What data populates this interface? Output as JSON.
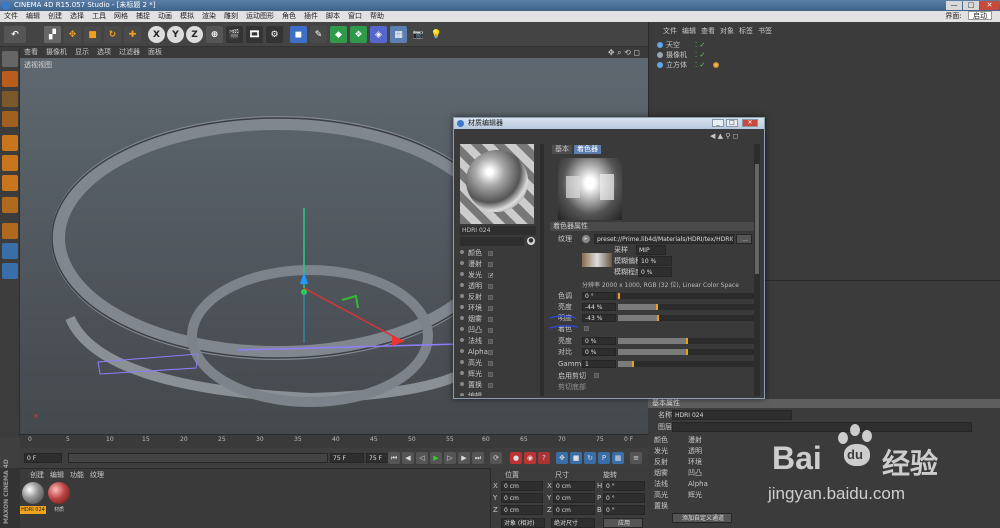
{
  "window": {
    "title": "CINEMA 4D R15.057 Studio - [未标题 2 *]",
    "min": "—",
    "max": "□",
    "close": "✕"
  },
  "menu": {
    "items": [
      "文件",
      "编辑",
      "创建",
      "选择",
      "工具",
      "网格",
      "捕捉",
      "动画",
      "模拟",
      "渲染",
      "雕刻",
      "运动图形",
      "角色",
      "插件",
      "脚本",
      "窗口",
      "帮助"
    ],
    "layout_label": "界面:",
    "layout_value": "启动"
  },
  "viewport": {
    "menu": [
      "查看",
      "摄像机",
      "显示",
      "选项",
      "过滤器",
      "面板"
    ],
    "label": "透视视图"
  },
  "timeline": {
    "ticks": [
      "0",
      "5",
      "10",
      "15",
      "20",
      "25",
      "30",
      "35",
      "40",
      "45",
      "50",
      "55",
      "60",
      "65",
      "70",
      "75"
    ],
    "end": "0 F"
  },
  "playback": {
    "start": "0 F",
    "current": "0 F",
    "end": "75 F",
    "end2": "75 F"
  },
  "material_manager": {
    "menu": [
      "创建",
      "编辑",
      "功能",
      "纹理"
    ],
    "materials": [
      {
        "name": "HDRI 024"
      },
      {
        "name": "材质"
      }
    ]
  },
  "maxon_label": "MAXON CINEMA 4D",
  "coords": {
    "headers": [
      "位置",
      "尺寸",
      "旋转"
    ],
    "rows": [
      {
        "a": "X",
        "v1": "0 cm",
        "b": "X",
        "v2": "0 cm",
        "c": "H",
        "v3": "0 °"
      },
      {
        "a": "Y",
        "v1": "0 cm",
        "b": "Y",
        "v2": "0 cm",
        "c": "P",
        "v3": "0 °"
      },
      {
        "a": "Z",
        "v1": "0 cm",
        "b": "Z",
        "v2": "0 cm",
        "c": "B",
        "v3": "0 °"
      }
    ],
    "mode1": "对象 (相对)",
    "mode2": "绝对尺寸",
    "apply": "应用"
  },
  "object_manager": {
    "menu": [
      "文件",
      "编辑",
      "查看",
      "对象",
      "标签",
      "书签"
    ],
    "objects": [
      {
        "name": "天空",
        "color": "#5fa7e8"
      },
      {
        "name": "摄像机",
        "color": "#9aa6b4"
      },
      {
        "name": "立方体",
        "color": "#5fa7e8"
      }
    ]
  },
  "attr_manager": {
    "section": "基本属性",
    "name_label": "名称",
    "name_value": "HDRI 024",
    "layer_label": "图层",
    "channels_left": [
      "颜色",
      "漫射",
      "发光",
      "透明",
      "反射",
      "环境",
      "烟雾",
      "凹凸",
      "法线",
      "Alpha",
      "高光",
      "辉光",
      "置换"
    ],
    "channels_right": [
      "漫射",
      "透明",
      "环境",
      "凹凸",
      "Alpha",
      "辉光"
    ],
    "add_button": "添加自定义通道"
  },
  "material_editor": {
    "title": "材质编辑器",
    "preview_name": "HDRI 024",
    "channels": [
      "颜色",
      "漫射",
      "发光",
      "透明",
      "反射",
      "环境",
      "烟雾",
      "凹凸",
      "法线",
      "Alpha",
      "高光",
      "辉光",
      "置换",
      "编辑"
    ],
    "tabs": [
      "基本",
      "着色器"
    ],
    "section": "着色器属性",
    "texture_label": "纹理",
    "texture_path": "preset://Prime.lib4d/Materials/HDRI/tex/HDRI024.",
    "browse": "...",
    "sampling_label": "采样",
    "sampling_value": "MIP",
    "blur_offset_label": "模糊偏移",
    "blur_offset_value": "10 %",
    "blur_scale_label": "模糊程度",
    "blur_scale_value": "0 %",
    "resolution": "分辨率 2000 x 1000, RGB (32 位), Linear Color Space",
    "params": [
      {
        "label": "色调",
        "value": "0 °",
        "fill": 0
      },
      {
        "label": "亮度",
        "value": "-44 %",
        "fill": 0.28
      },
      {
        "label": "明度",
        "value": "-43 %",
        "fill": 0.29
      },
      {
        "label": "着色",
        "value": ""
      },
      {
        "label": "亮度",
        "value": "0 %",
        "fill": 0.5
      },
      {
        "label": "对比",
        "value": "0 %",
        "fill": 0.5
      },
      {
        "label": "Gamma",
        "value": "1",
        "fill": 0.1
      },
      {
        "label": "启用剪切",
        "value": ""
      },
      {
        "label": "剪切底部",
        "value": ""
      }
    ]
  },
  "watermark": {
    "brand": "Bai",
    "paw": "du",
    "cn": "经验",
    "url": "jingyan.baidu.com"
  }
}
